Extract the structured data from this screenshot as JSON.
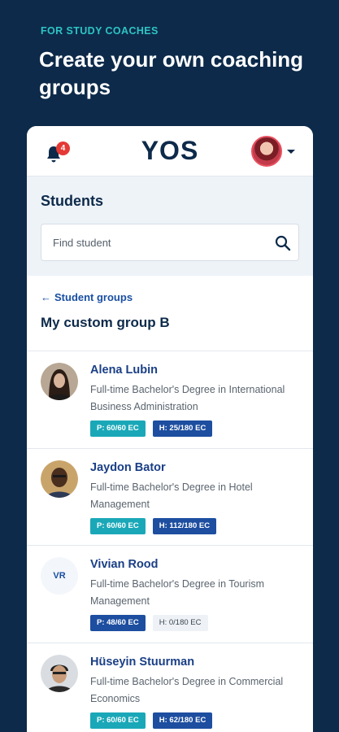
{
  "promo": {
    "eyebrow": "FOR STUDY COACHES",
    "title": "Create your own coaching groups"
  },
  "topbar": {
    "notification_count": "4",
    "logo": "YOS"
  },
  "students": {
    "title": "Students",
    "search_placeholder": "Find student"
  },
  "group": {
    "back_label": "Student groups",
    "title": "My custom group B"
  },
  "list": [
    {
      "name": "Alena Lubin",
      "program": "Full-time Bachelor's Degree in International Business Administration",
      "badge_p": "P: 60/60 EC",
      "badge_h": "H: 25/180 EC"
    },
    {
      "name": "Jaydon Bator",
      "program": "Full-time Bachelor's Degree in Hotel Management",
      "badge_p": "P: 60/60 EC",
      "badge_h": "H: 112/180 EC"
    },
    {
      "name": "Vivian Rood",
      "initials": "VR",
      "program": "Full-time Bachelor's Degree in Tourism Management",
      "badge_p": "P: 48/60 EC",
      "badge_h": "H: 0/180 EC"
    },
    {
      "name": "Hüseyin Stuurman",
      "program": "Full-time Bachelor's Degree in Commercial Economics",
      "badge_p": "P: 60/60 EC",
      "badge_h": "H: 62/180 EC"
    }
  ],
  "colors": {
    "background": "#0d2a4a",
    "accent_teal": "#1aa8b8",
    "accent_blue": "#1d4ea0",
    "badge_red": "#e53935"
  }
}
